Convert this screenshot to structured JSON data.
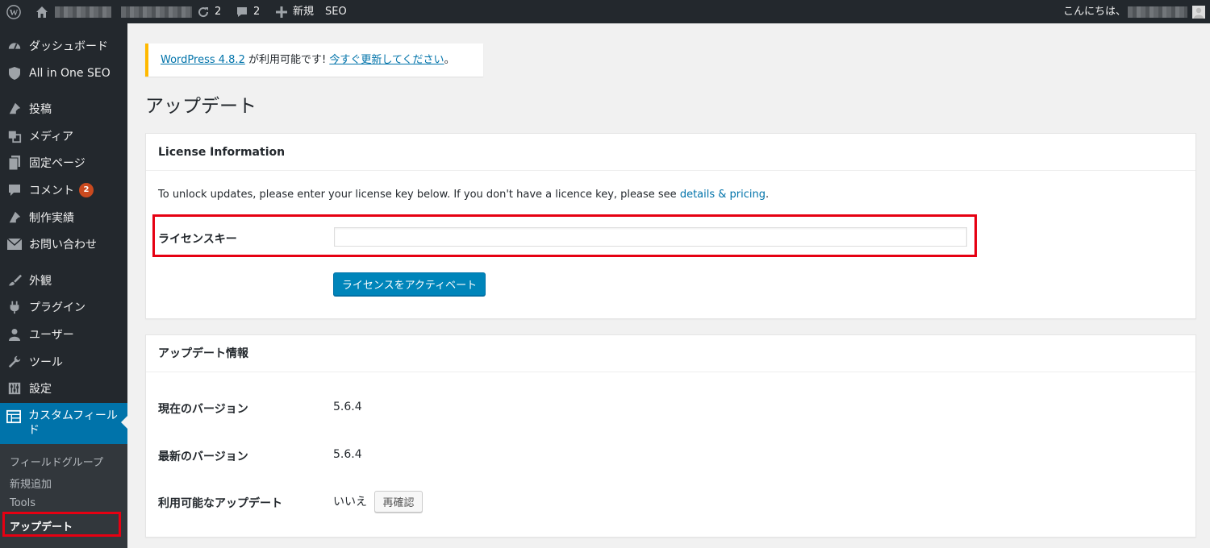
{
  "adminbar": {
    "updates_count": "2",
    "comments_count": "2",
    "new_label": "新規",
    "seo_label": "SEO",
    "greeting": "こんにちは、"
  },
  "sidebar": {
    "items": [
      {
        "label": "ダッシュボード",
        "icon": "dashboard-icon"
      },
      {
        "label": "All in One SEO",
        "icon": "shield-icon"
      },
      {
        "label": "投稿",
        "icon": "pin-icon"
      },
      {
        "label": "メディア",
        "icon": "media-icon"
      },
      {
        "label": "固定ページ",
        "icon": "page-icon"
      },
      {
        "label": "コメント",
        "icon": "comment-icon",
        "badge": "2"
      },
      {
        "label": "制作実績",
        "icon": "pin-icon"
      },
      {
        "label": "お問い合わせ",
        "icon": "mail-icon"
      },
      {
        "label": "外観",
        "icon": "brush-icon"
      },
      {
        "label": "プラグイン",
        "icon": "plugin-icon"
      },
      {
        "label": "ユーザー",
        "icon": "user-icon"
      },
      {
        "label": "ツール",
        "icon": "wrench-icon"
      },
      {
        "label": "設定",
        "icon": "settings-icon"
      }
    ],
    "current": {
      "label": "カスタムフィールド",
      "icon": "table-icon"
    },
    "submenu": [
      "フィールドグループ",
      "新規追加",
      "Tools",
      "アップデート"
    ]
  },
  "notice": {
    "version_link": "WordPress 4.8.2",
    "middle": " が利用可能です! ",
    "update_link": "今すぐ更新してください",
    "end": "。"
  },
  "page": {
    "title": "アップデート"
  },
  "license": {
    "heading": "License Information",
    "desc": "To unlock updates, please enter your license key below. If you don't have a licence key, please see ",
    "desc_link": "details & pricing",
    "desc_end": ".",
    "field_label": "ライセンスキー",
    "input_value": "",
    "button": "ライセンスをアクティベート"
  },
  "update_info": {
    "heading": "アップデート情報",
    "rows": [
      {
        "label": "現在のバージョン",
        "value": "5.6.4"
      },
      {
        "label": "最新のバージョン",
        "value": "5.6.4"
      },
      {
        "label": "利用可能なアップデート",
        "value": "いいえ"
      }
    ],
    "recheck_button": "再確認"
  },
  "colors": {
    "adminbar_bg": "#23282d",
    "accent": "#0073aa",
    "notice_border": "#ffb900",
    "highlight_box": "#e60012",
    "badge": "#ca4a1f"
  }
}
